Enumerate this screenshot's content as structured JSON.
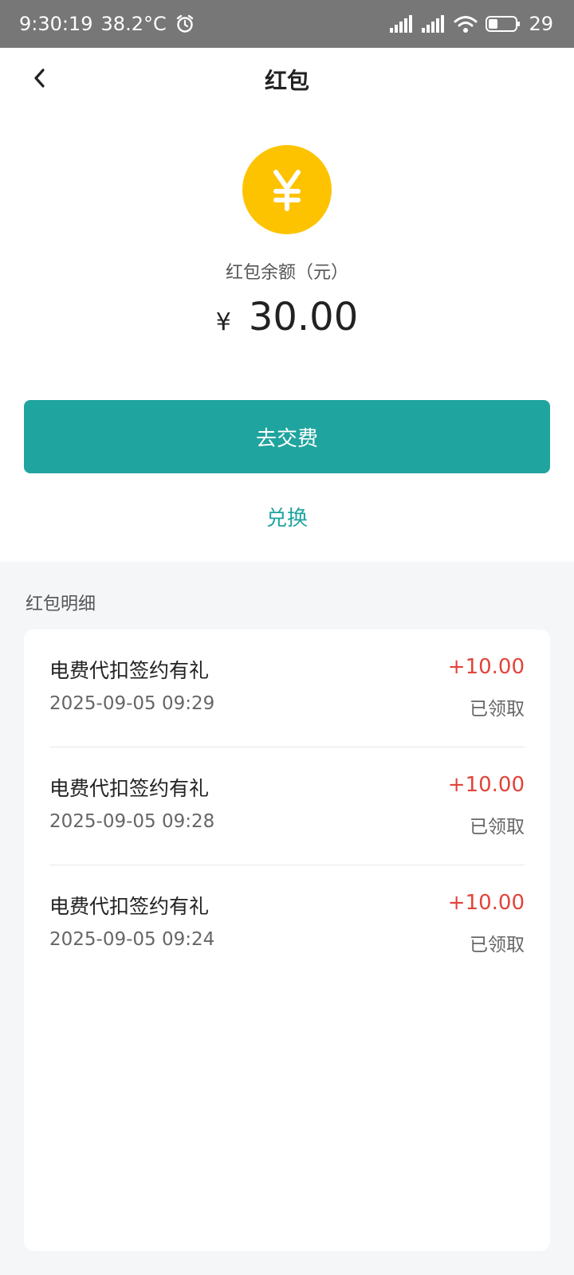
{
  "status_bar": {
    "time": "9:30:19",
    "temperature": "38.2°C",
    "battery": "29"
  },
  "nav": {
    "title": "红包"
  },
  "balance": {
    "label": "红包余额（元）",
    "currency": "¥",
    "amount": "30.00"
  },
  "actions": {
    "pay_label": "去交费",
    "exchange_label": "兑换"
  },
  "details": {
    "section_title": "红包明细",
    "records": [
      {
        "title": "电费代扣签约有礼",
        "time": "2025-09-05 09:29",
        "amount": "+10.00",
        "status": "已领取"
      },
      {
        "title": "电费代扣签约有礼",
        "time": "2025-09-05 09:28",
        "amount": "+10.00",
        "status": "已领取"
      },
      {
        "title": "电费代扣签约有礼",
        "time": "2025-09-05 09:24",
        "amount": "+10.00",
        "status": "已领取"
      }
    ]
  },
  "colors": {
    "accent": "#20a49f",
    "coin": "#fdc300",
    "amount_positive": "#e1443a"
  }
}
